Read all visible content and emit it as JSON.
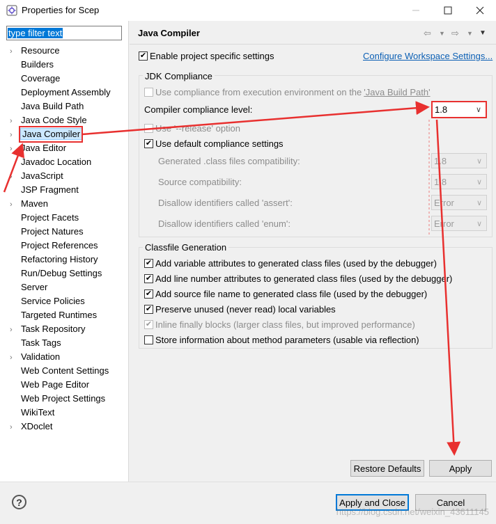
{
  "window": {
    "title": "Properties for Scep"
  },
  "filter": {
    "text": "type filter text"
  },
  "tree": [
    {
      "label": "Resource",
      "expandable": true
    },
    {
      "label": "Builders",
      "expandable": false
    },
    {
      "label": "Coverage",
      "expandable": false
    },
    {
      "label": "Deployment Assembly",
      "expandable": false
    },
    {
      "label": "Java Build Path",
      "expandable": false
    },
    {
      "label": "Java Code Style",
      "expandable": true
    },
    {
      "label": "Java Compiler",
      "expandable": true,
      "selected": true
    },
    {
      "label": "Java Editor",
      "expandable": true
    },
    {
      "label": "Javadoc Location",
      "expandable": false
    },
    {
      "label": "JavaScript",
      "expandable": true
    },
    {
      "label": "JSP Fragment",
      "expandable": false
    },
    {
      "label": "Maven",
      "expandable": true
    },
    {
      "label": "Project Facets",
      "expandable": false
    },
    {
      "label": "Project Natures",
      "expandable": false
    },
    {
      "label": "Project References",
      "expandable": false
    },
    {
      "label": "Refactoring History",
      "expandable": false
    },
    {
      "label": "Run/Debug Settings",
      "expandable": false
    },
    {
      "label": "Server",
      "expandable": false
    },
    {
      "label": "Service Policies",
      "expandable": false
    },
    {
      "label": "Targeted Runtimes",
      "expandable": false
    },
    {
      "label": "Task Repository",
      "expandable": true
    },
    {
      "label": "Task Tags",
      "expandable": false
    },
    {
      "label": "Validation",
      "expandable": true
    },
    {
      "label": "Web Content Settings",
      "expandable": false
    },
    {
      "label": "Web Page Editor",
      "expandable": false
    },
    {
      "label": "Web Project Settings",
      "expandable": false
    },
    {
      "label": "WikiText",
      "expandable": false
    },
    {
      "label": "XDoclet",
      "expandable": true
    }
  ],
  "page": {
    "title": "Java Compiler",
    "enable_project_specific": "Enable project specific settings",
    "configure_link": "Configure Workspace Settings..."
  },
  "jdk": {
    "group_label": "JDK Compliance",
    "use_env_text": "Use compliance from execution environment on the ",
    "use_env_link": "'Java Build Path'",
    "level_label": "Compiler compliance level:",
    "level_value": "1.8",
    "release_option": "Use '--release' option",
    "use_default": "Use default compliance settings",
    "generated_label": "Generated .class files compatibility:",
    "generated_value": "1.8",
    "source_label": "Source compatibility:",
    "source_value": "1.8",
    "assert_label": "Disallow identifiers called 'assert':",
    "assert_value": "Error",
    "enum_label": "Disallow identifiers called 'enum':",
    "enum_value": "Error"
  },
  "classfile": {
    "group_label": "Classfile Generation",
    "items": [
      {
        "label": "Add variable attributes to generated class files (used by the debugger)",
        "checked": true
      },
      {
        "label": "Add line number attributes to generated class files (used by the debugger)",
        "checked": true
      },
      {
        "label": "Add source file name to generated class file (used by the debugger)",
        "checked": true
      },
      {
        "label": "Preserve unused (never read) local variables",
        "checked": true
      },
      {
        "label": "Inline finally blocks (larger class files, but improved performance)",
        "checked": true
      },
      {
        "label": "Store information about method parameters (usable via reflection)",
        "checked": false
      }
    ]
  },
  "buttons": {
    "restore_defaults": "Restore Defaults",
    "apply": "Apply",
    "apply_close": "Apply and Close",
    "cancel": "Cancel",
    "help": "?"
  },
  "watermark": "https://blog.csdn.net/weixin_43611145",
  "colors": {
    "annotation_red": "#e8302f",
    "selection_blue": "#0078d7"
  }
}
